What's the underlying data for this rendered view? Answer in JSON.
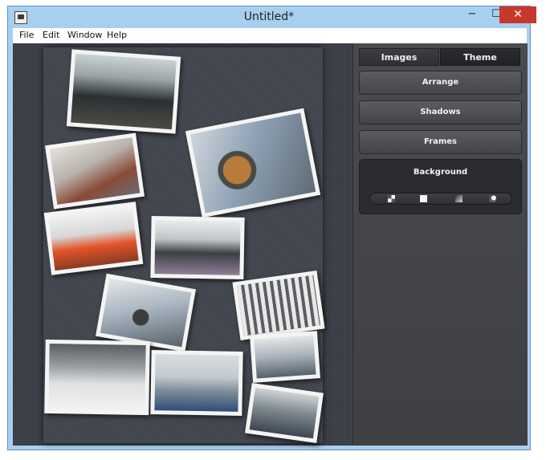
{
  "window": {
    "title": "Untitled*"
  },
  "controls": {
    "minimize": "−",
    "maximize": "☐",
    "close": "✕"
  },
  "menu": [
    "File",
    "Edit",
    "Window",
    "Help"
  ],
  "panel": {
    "tabs": [
      "Images",
      "Theme"
    ],
    "buttons": [
      "Arrange",
      "Shadows",
      "Frames"
    ],
    "background_label": "Background",
    "background_options": [
      "checker-pattern-icon",
      "solid-color-icon",
      "gradient-icon",
      "image-icon"
    ]
  },
  "colors": {
    "accent_close": "#c7382b",
    "window_frame": "#a9cff0"
  },
  "photos": [
    "conference-room",
    "boardroom-long-table",
    "presentation-screen",
    "orange-chairs-room",
    "office-chairs-room",
    "hanging-chair-lounge",
    "classroom-white-chairs",
    "training-room",
    "glass-partition-room",
    "small-meeting-room",
    "lounge-tables"
  ]
}
